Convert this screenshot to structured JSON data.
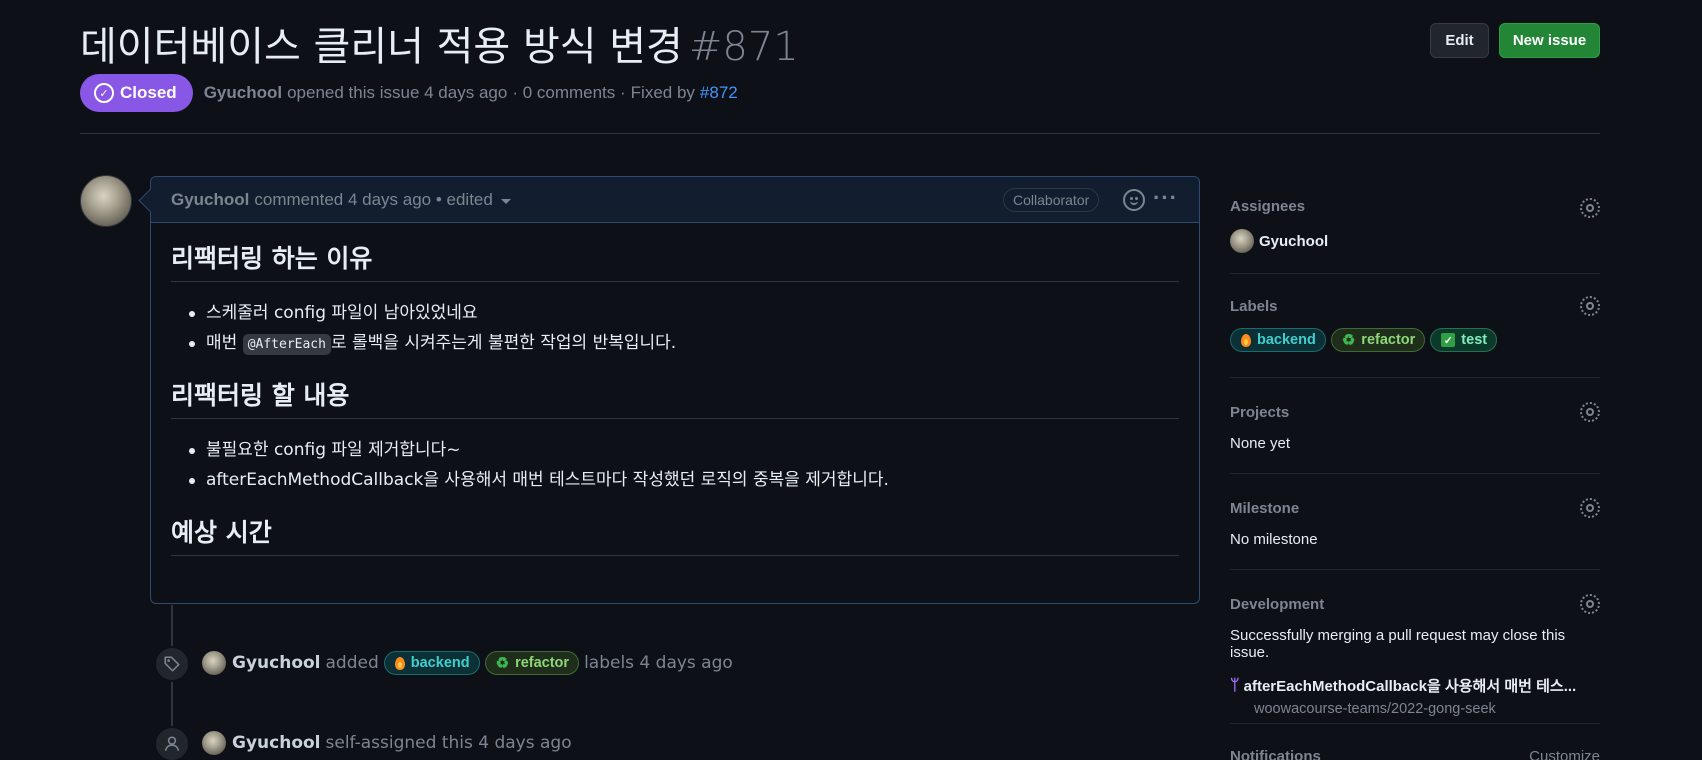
{
  "issue": {
    "title": "데이터베이스 클리너 적용 방식 변경",
    "number": "#871",
    "state": "Closed",
    "author": "Gyuchool",
    "opened_text": "opened this issue 4 days ago",
    "comments_text": "· 0 comments ·",
    "fixed_by_label": "Fixed by",
    "fixed_by_link": "#872"
  },
  "header": {
    "edit_label": "Edit",
    "new_issue_label": "New issue"
  },
  "comment": {
    "author": "Gyuchool",
    "meta": "commented 4 days ago • edited",
    "role_badge": "Collaborator",
    "sections": [
      {
        "heading": "리팩터링 하는 이유",
        "items": [
          "스케줄러 config 파일이 남아있었네요",
          "로 롤백을 시켜주는게 불편한 작업의 반복입니다."
        ]
      },
      {
        "heading": "리팩터링 할 내용",
        "items": [
          "불필요한 config 파일 제거합니다~",
          "afterEachMethodCallback을 사용해서 매번 테스트마다 작성했던 로직의 중복을 제거합니다."
        ]
      },
      {
        "heading": "예상 시간",
        "items": []
      }
    ],
    "inline_code": "@AfterEach",
    "item_prefix": "매번"
  },
  "timeline": [
    {
      "icon": "tag-icon",
      "author": "Gyuchool",
      "action": "added",
      "labels": [
        "backend",
        "refactor"
      ],
      "suffix": "labels 4 days ago"
    },
    {
      "icon": "person-icon",
      "author": "Gyuchool",
      "action": "self-assigned this 4 days ago"
    }
  ],
  "sidebar": {
    "assignees": {
      "title": "Assignees",
      "value": "Gyuchool"
    },
    "labels": {
      "title": "Labels",
      "items": [
        "backend",
        "refactor",
        "test"
      ]
    },
    "projects": {
      "title": "Projects",
      "value": "None yet"
    },
    "milestone": {
      "title": "Milestone",
      "value": "No milestone"
    },
    "development": {
      "title": "Development",
      "description": "Successfully merging a pull request may close this issue.",
      "pr_title": "afterEachMethodCallback을 사용해서 매번 테스...",
      "repo": "woowacourse-teams/2022-gong-seek"
    },
    "notifications": {
      "title": "Notifications",
      "action": "Customize"
    }
  },
  "colors": {
    "closed_badge": "#8957e5",
    "new_issue_button": "#238636",
    "link": "#4493f8",
    "background": "#0d1117"
  }
}
